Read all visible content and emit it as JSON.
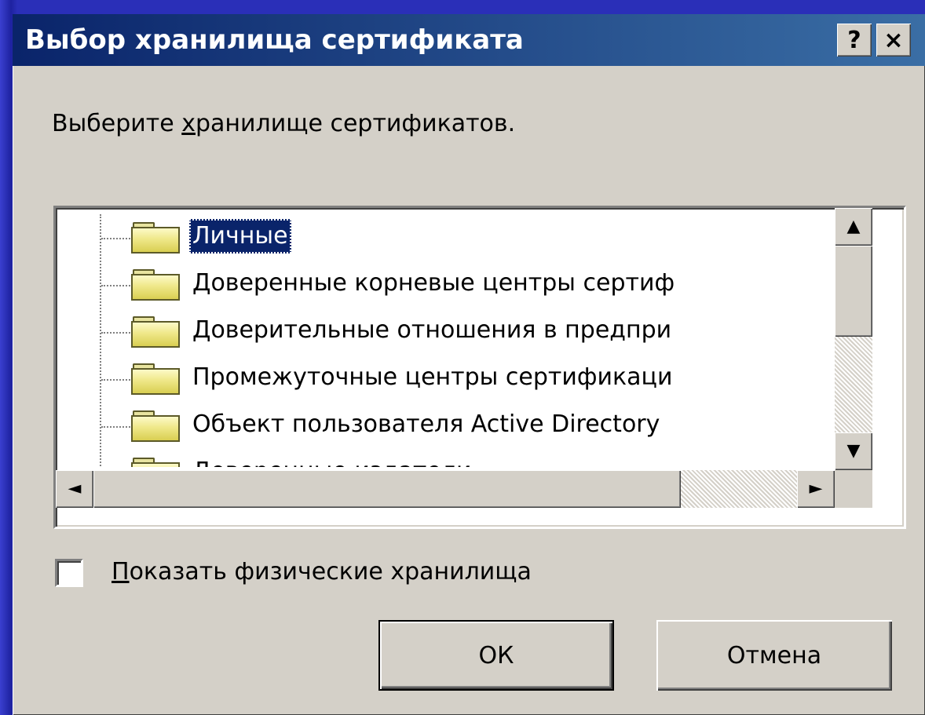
{
  "window": {
    "title": "Выбор хранилища сертификата",
    "help_glyph": "?",
    "close_glyph": "×"
  },
  "prompt": {
    "before": "Выберите ",
    "accel": "х",
    "after": "ранилище сертификатов."
  },
  "tree": {
    "items": [
      {
        "label": "Личные",
        "selected": true,
        "icon": "folder-icon"
      },
      {
        "label": "Доверенные корневые центры сертиф",
        "selected": false,
        "icon": "folder-icon"
      },
      {
        "label": "Доверительные отношения в предпри",
        "selected": false,
        "icon": "folder-icon"
      },
      {
        "label": "Промежуточные центры сертификаци",
        "selected": false,
        "icon": "folder-icon"
      },
      {
        "label": "Объект пользователя Active Directory",
        "selected": false,
        "icon": "folder-icon"
      },
      {
        "label": "Доверенные издатели",
        "selected": false,
        "icon": "folder-icon"
      }
    ]
  },
  "scrollbars": {
    "up_glyph": "▲",
    "down_glyph": "▼",
    "left_glyph": "◄",
    "right_glyph": "►"
  },
  "checkbox": {
    "accel": "П",
    "rest": "оказать физические хранилища",
    "checked": false
  },
  "buttons": {
    "ok": "ОК",
    "cancel": "Отмена"
  }
}
